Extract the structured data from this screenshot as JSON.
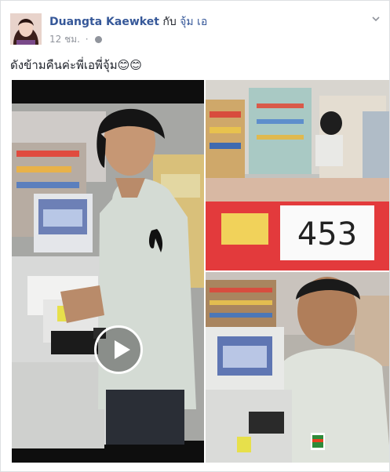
{
  "post": {
    "author": "Duangta Kaewket",
    "with_text": "กับ",
    "tagged_user": "จุ้ม เอ",
    "timestamp": "12 ชม.",
    "meta_separator": "·",
    "privacy_icon": "globe-icon",
    "options_icon": "chevron-down-icon",
    "caption": "ดังข้ามคืนค่ะพี่เอพี่จุ้ม😊😊"
  },
  "media": {
    "video_play_icon": "play-icon",
    "photo_count": 3
  },
  "colors": {
    "link_blue": "#365899",
    "meta_gray": "#90949c",
    "text_dark": "#1d2129"
  }
}
